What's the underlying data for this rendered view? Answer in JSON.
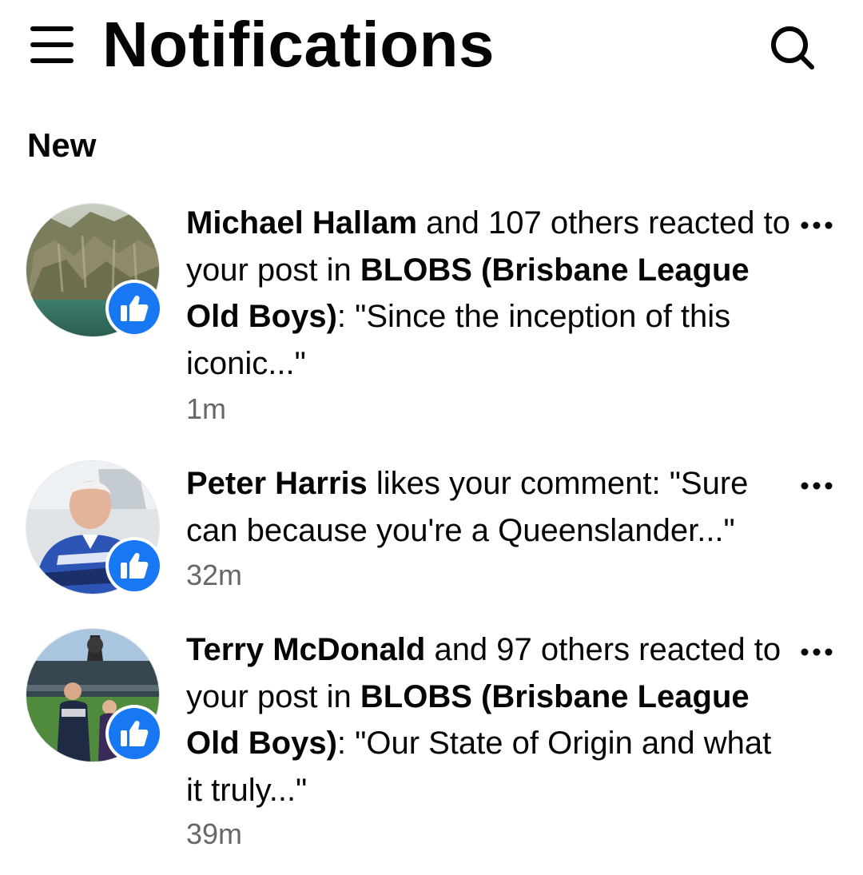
{
  "header": {
    "title": "Notifications",
    "menu_icon": "hamburger-menu-icon",
    "search_icon": "search-icon"
  },
  "section": {
    "title": "New"
  },
  "notifications": [
    {
      "actor": "Michael Hallam",
      "segments": [
        {
          "text": "Michael Hallam",
          "bold": true
        },
        {
          "text": " and 107 others reacted to your post in ",
          "bold": false
        },
        {
          "text": "BLOBS (Brisbane League Old Boys)",
          "bold": true
        },
        {
          "text": ": \"Since the inception of this iconic...\"",
          "bold": false
        }
      ],
      "time": "1m",
      "reaction_icon": "like-icon",
      "more_icon": "more-options-icon"
    },
    {
      "actor": "Peter Harris",
      "segments": [
        {
          "text": "Peter Harris",
          "bold": true
        },
        {
          "text": " likes your comment: \"Sure can because you're a Queenslander...\"",
          "bold": false
        }
      ],
      "time": "32m",
      "reaction_icon": "like-icon",
      "more_icon": "more-options-icon"
    },
    {
      "actor": "Terry McDonald",
      "segments": [
        {
          "text": "Terry McDonald",
          "bold": true
        },
        {
          "text": " and 97 others reacted to your post in ",
          "bold": false
        },
        {
          "text": "BLOBS (Brisbane League Old Boys)",
          "bold": true
        },
        {
          "text": ": \"Our State of Origin and what it truly...\"",
          "bold": false
        }
      ],
      "time": "39m",
      "reaction_icon": "like-icon",
      "more_icon": "more-options-icon"
    }
  ],
  "colors": {
    "accent": "#1877f2",
    "text_primary": "#050505",
    "text_secondary": "#65676b",
    "background": "#ffffff"
  }
}
